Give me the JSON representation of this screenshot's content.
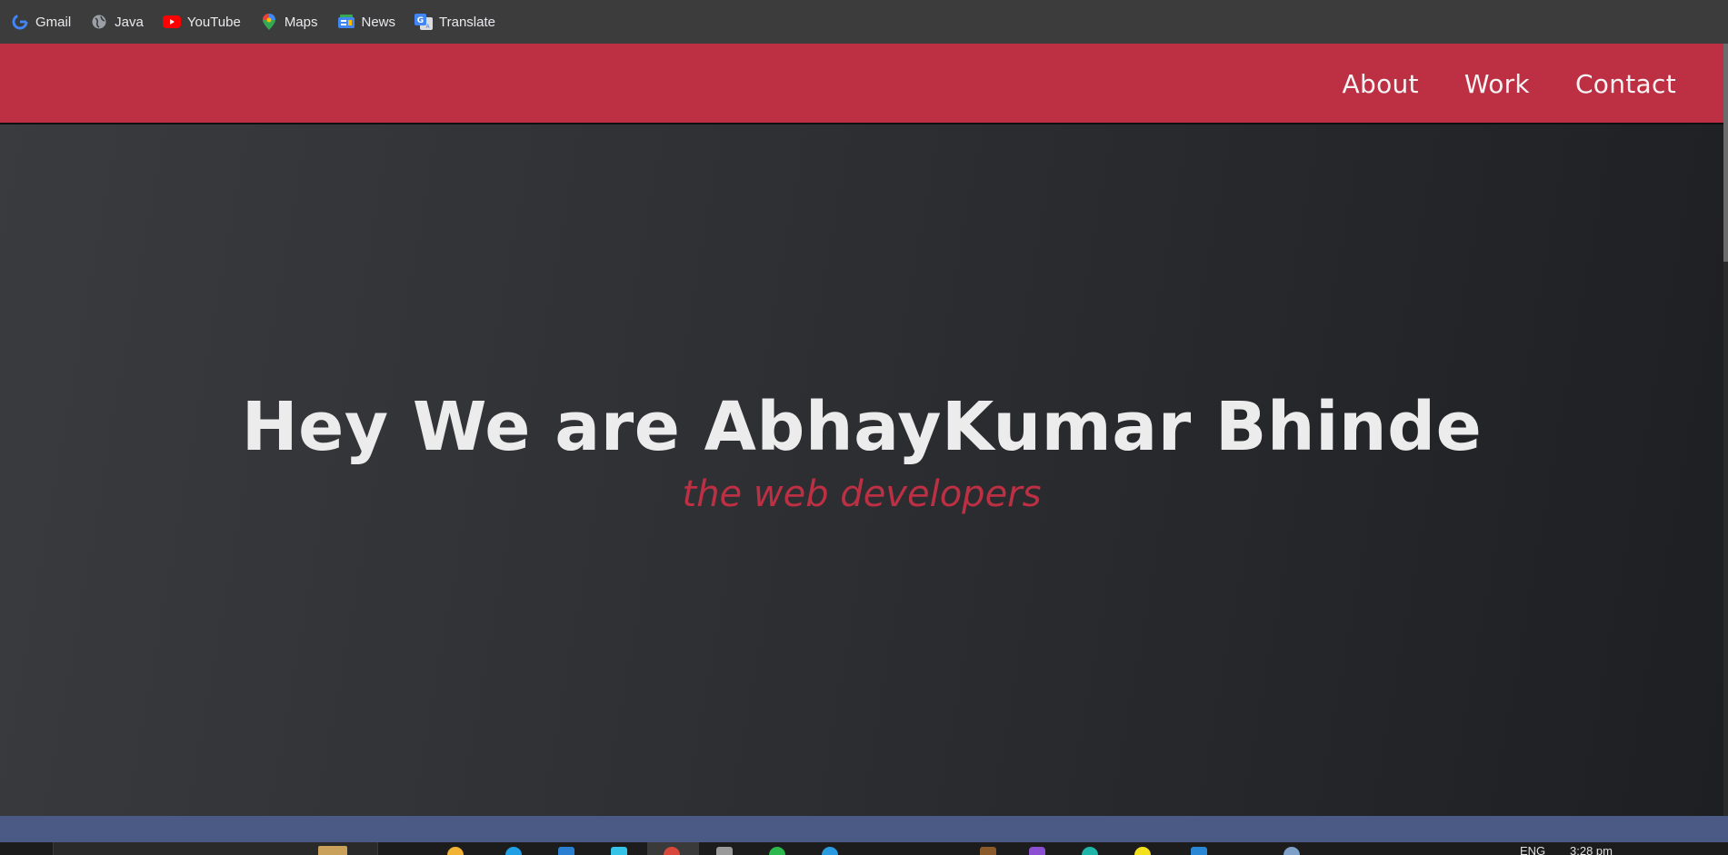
{
  "bookmarks": [
    {
      "label": "Gmail",
      "icon": "google-g-icon"
    },
    {
      "label": "Java",
      "icon": "globe-icon"
    },
    {
      "label": "YouTube",
      "icon": "youtube-icon"
    },
    {
      "label": "Maps",
      "icon": "maps-pin-icon"
    },
    {
      "label": "News",
      "icon": "news-icon"
    },
    {
      "label": "Translate",
      "icon": "translate-icon"
    }
  ],
  "nav": {
    "links": [
      "About",
      "Work",
      "Contact"
    ]
  },
  "hero": {
    "title": "Hey We are AbhayKumar Bhinde",
    "subtitle": "the web developers"
  },
  "taskbar": {
    "language": "ENG",
    "time": "3:28 pm"
  },
  "colors": {
    "accent": "#bd3044",
    "bookmark_bar": "#3c3c3c",
    "hero_text": "#ececec"
  }
}
